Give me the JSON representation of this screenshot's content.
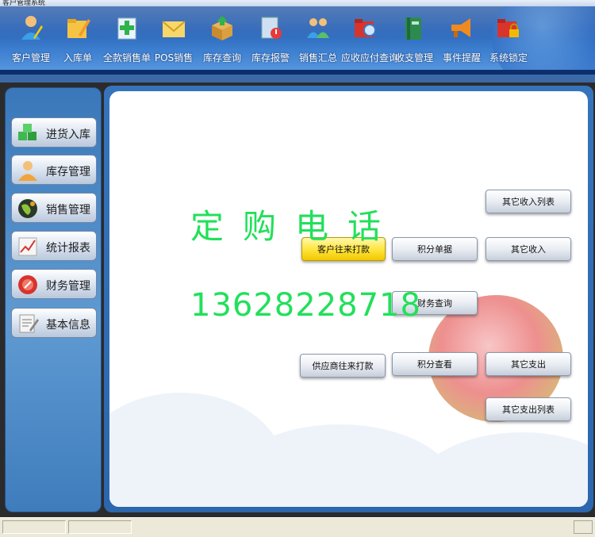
{
  "window": {
    "title": "客户管理系统"
  },
  "toolbar": {
    "items": [
      {
        "label": "客户管理",
        "icon": "person-icon"
      },
      {
        "label": "入库单",
        "icon": "folder-pencil-icon"
      },
      {
        "label": "全款销售单",
        "icon": "document-add-icon"
      },
      {
        "label": "POS销售",
        "icon": "envelope-icon"
      },
      {
        "label": "库存查询",
        "icon": "box-arrow-icon"
      },
      {
        "label": "库存报警",
        "icon": "document-alert-icon"
      },
      {
        "label": "销售汇总",
        "icon": "people-icon"
      },
      {
        "label": "应收应付查询",
        "icon": "folder-search-icon"
      },
      {
        "label": "收支管理",
        "icon": "book-icon"
      },
      {
        "label": "事件提醒",
        "icon": "megaphone-icon"
      },
      {
        "label": "系统锁定",
        "icon": "folder-lock-icon"
      }
    ]
  },
  "sidebar": {
    "items": [
      {
        "label": "进货入库",
        "icon": "cubes-icon"
      },
      {
        "label": "库存管理",
        "icon": "user-icon"
      },
      {
        "label": "销售管理",
        "icon": "globe-icon"
      },
      {
        "label": "统计报表",
        "icon": "chart-icon"
      },
      {
        "label": "财务管理",
        "icon": "finance-icon"
      },
      {
        "label": "基本信息",
        "icon": "notes-icon"
      }
    ]
  },
  "panel": {
    "buttons": {
      "customer_payment": "客户往来打款",
      "points_doc": "积分单据",
      "other_income_list": "其它收入列表",
      "other_income": "其它收入",
      "finance_query": "财务查询",
      "supplier_payment": "供应商往来打款",
      "points_view": "积分查看",
      "other_expense": "其它支出",
      "other_expense_list": "其它支出列表"
    },
    "overlay": {
      "line1": "定购电话",
      "line2": "13628228718"
    }
  },
  "colors": {
    "overlay_text": "#22e05a",
    "active_button": "#ffe640",
    "toolbar_blue": "#2d66b8"
  }
}
